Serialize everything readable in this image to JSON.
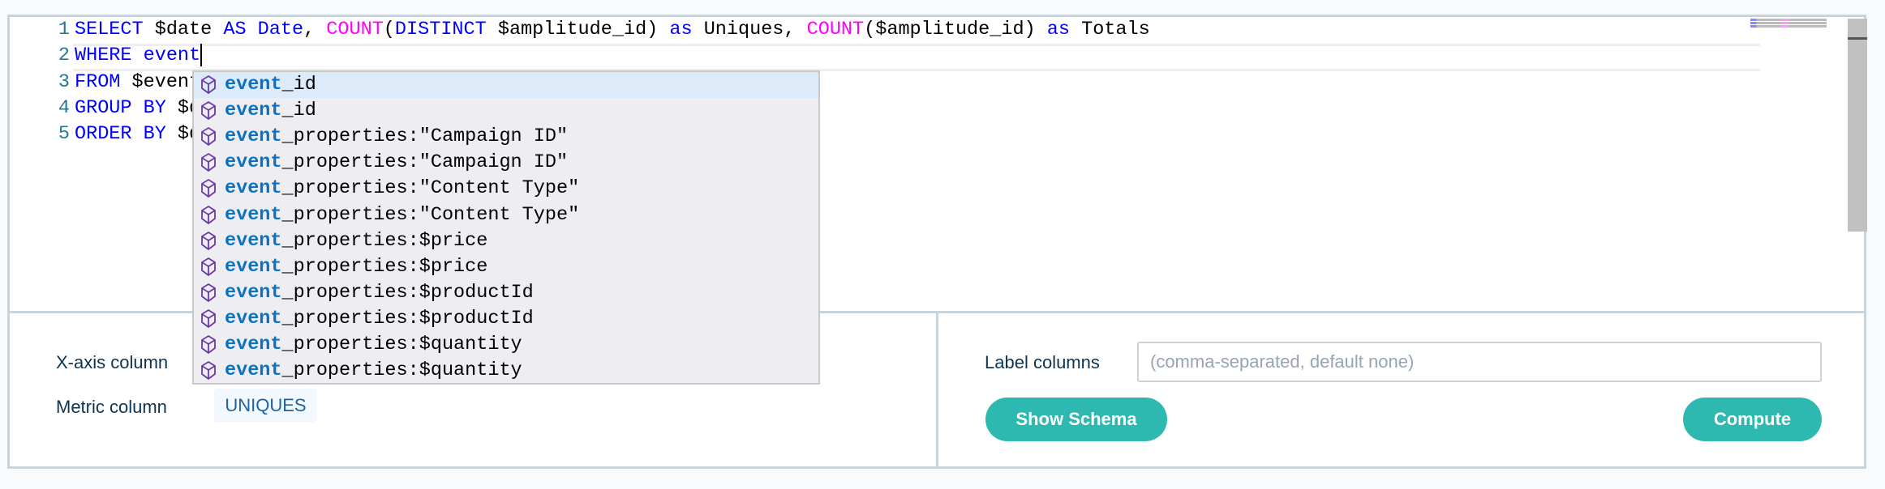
{
  "editor": {
    "lines": [
      {
        "num": "1",
        "tokens": [
          [
            "kw",
            "SELECT"
          ],
          [
            "tx",
            " $date "
          ],
          [
            "kw",
            "AS Date"
          ],
          [
            "tx",
            ", "
          ],
          [
            "fn",
            "COUNT"
          ],
          [
            "tx",
            "("
          ],
          [
            "kw",
            "DISTINCT"
          ],
          [
            "tx",
            " $amplitude_id) "
          ],
          [
            "kw",
            "as"
          ],
          [
            "tx",
            " Uniques, "
          ],
          [
            "fn",
            "COUNT"
          ],
          [
            "tx",
            "($amplitude_id) "
          ],
          [
            "kw",
            "as"
          ],
          [
            "tx",
            " Totals"
          ]
        ]
      },
      {
        "num": "2",
        "tokens": [
          [
            "kw",
            "WHERE event"
          ]
        ]
      },
      {
        "num": "3",
        "tokens": [
          [
            "kw",
            "FROM"
          ],
          [
            "tx",
            " $event"
          ]
        ]
      },
      {
        "num": "4",
        "tokens": [
          [
            "kw",
            "GROUP BY"
          ],
          [
            "tx",
            " $d"
          ]
        ]
      },
      {
        "num": "5",
        "tokens": [
          [
            "kw",
            "ORDER BY"
          ],
          [
            "tx",
            " $d"
          ]
        ]
      }
    ]
  },
  "suggestions": {
    "match": "event",
    "items": [
      "_id",
      "_id",
      "_properties:\"Campaign ID\"",
      "_properties:\"Campaign ID\"",
      "_properties:\"Content Type\"",
      "_properties:\"Content Type\"",
      "_properties:$price",
      "_properties:$price",
      "_properties:$productId",
      "_properties:$productId",
      "_properties:$quantity",
      "_properties:$quantity"
    ],
    "icon": "property-cube-icon",
    "icon_color": "#6c3aa0"
  },
  "settings": {
    "xaxis_label": "X-axis column",
    "metric_label": "Metric column",
    "metric_value": "UNIQUES",
    "label_columns_label": "Label columns",
    "label_columns_placeholder": "(comma-separated, default none)",
    "show_schema": "Show Schema",
    "compute": "Compute"
  },
  "colors": {
    "accent": "#2db9b0",
    "keyword": "#0000ff",
    "function": "#ff00ff"
  }
}
